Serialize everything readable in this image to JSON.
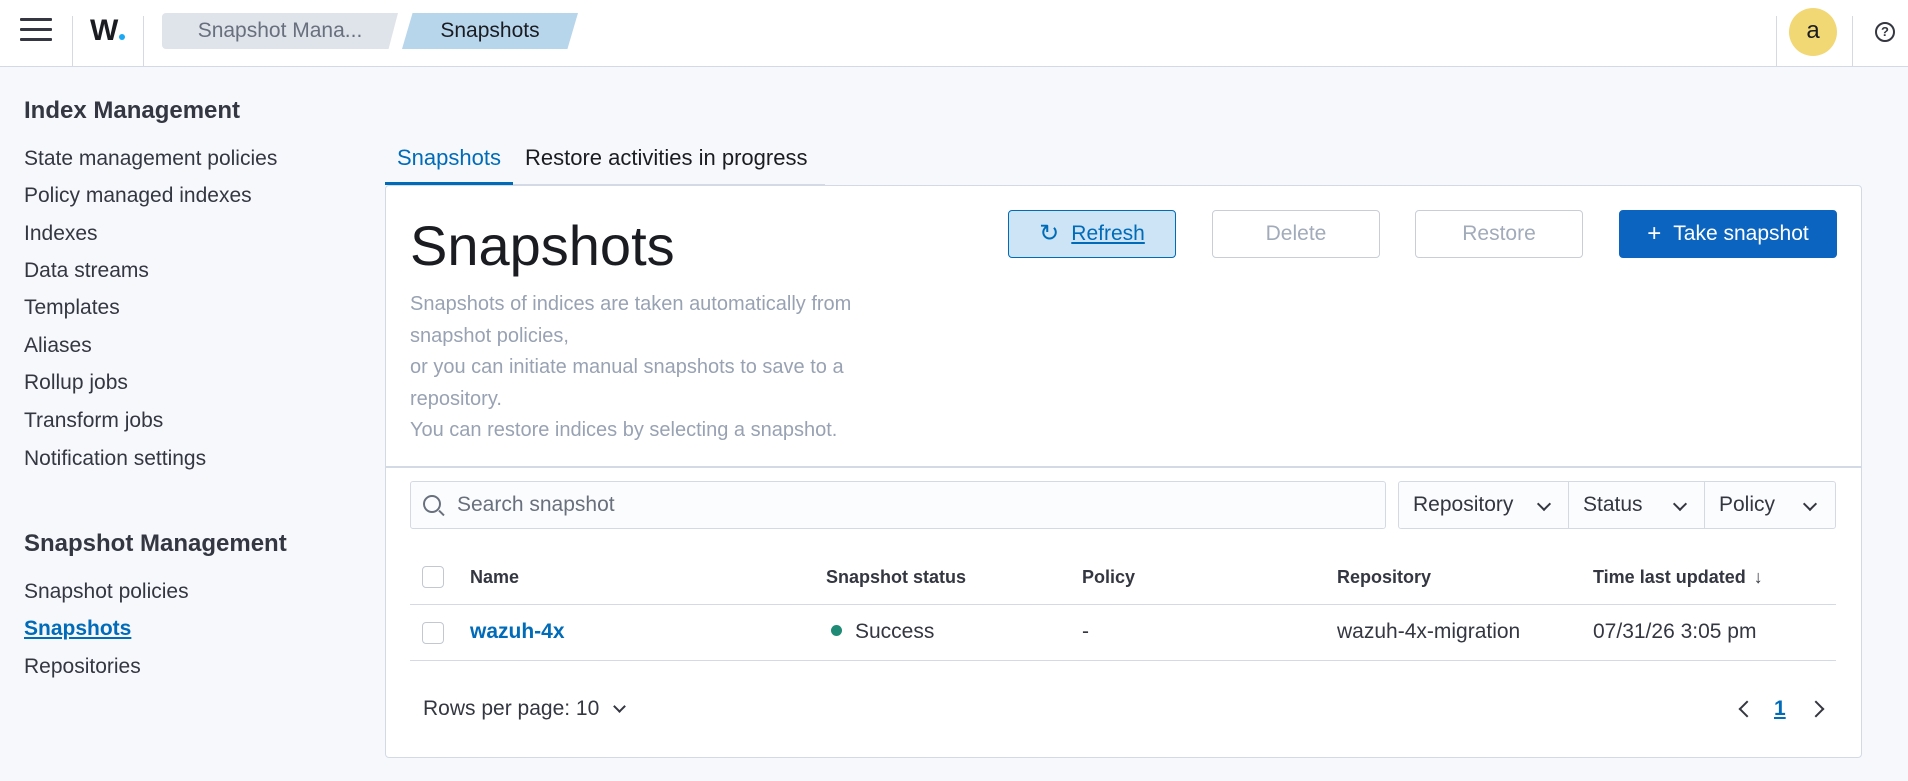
{
  "header": {
    "logo_text": "W",
    "breadcrumbs": [
      "Snapshot Mana...",
      "Snapshots"
    ],
    "avatar_letter": "a",
    "help_symbol": "?",
    "icons": [
      "menu-icon",
      "help-icon"
    ]
  },
  "sidebar": {
    "sections": [
      {
        "title": "Index Management",
        "items": [
          "State management policies",
          "Policy managed indexes",
          "Indexes",
          "Data streams",
          "Templates",
          "Aliases",
          "Rollup jobs",
          "Transform jobs",
          "Notification settings"
        ]
      },
      {
        "title": "Snapshot Management",
        "items": [
          "Snapshot policies",
          "Snapshots",
          "Repositories"
        ],
        "active": "Snapshots"
      }
    ]
  },
  "tabs": [
    {
      "label": "Snapshots",
      "active": true
    },
    {
      "label": "Restore activities in progress",
      "active": false
    }
  ],
  "main": {
    "title": "Snapshots",
    "description_lines": [
      "Snapshots of indices are taken automatically from",
      "snapshot policies,",
      "or you can initiate manual snapshots to save to a",
      "repository.",
      "You can restore indices by selecting a snapshot."
    ],
    "buttons": {
      "refresh": "Refresh",
      "delete": "Delete",
      "restore": "Restore",
      "take_snapshot": "Take snapshot"
    },
    "search_placeholder": "Search snapshot",
    "filters": [
      "Repository",
      "Status",
      "Policy"
    ]
  },
  "table": {
    "columns": [
      "Name",
      "Snapshot status",
      "Policy",
      "Repository",
      "Time last updated"
    ],
    "sorted_column": "Time last updated",
    "sort_direction": "descending",
    "rows": [
      {
        "name": "wazuh-4x",
        "status": "Success",
        "policy": "-",
        "repository": "wazuh-4x-migration",
        "time": "07/31/26 3:05 pm"
      }
    ]
  },
  "pagination": {
    "rows_per_page": "Rows per page: 10",
    "current_page": "1"
  },
  "colors": {
    "accent": "#006bb8",
    "primary_button": "#0b64c0",
    "success": "#1f8a75",
    "avatar": "#f2d775"
  }
}
